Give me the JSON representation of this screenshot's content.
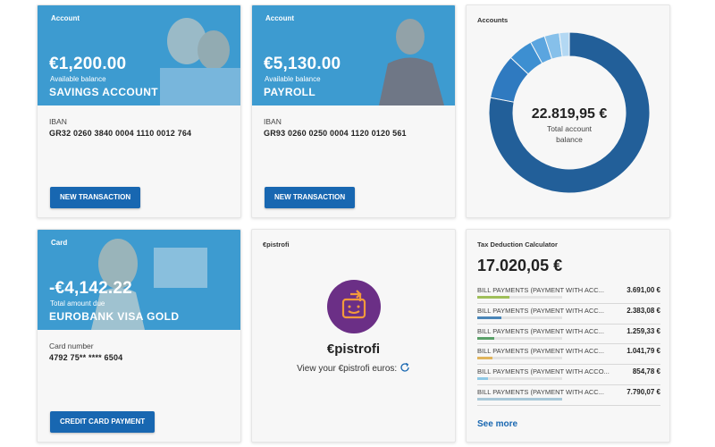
{
  "savings": {
    "tag": "Account",
    "amount": "€1,200.00",
    "amount_caption": "Available balance",
    "name": "SAVINGS ACCOUNT",
    "iban_label": "IBAN",
    "iban": "GR32 0260 3840 0004 1110 0012 764",
    "button": "NEW TRANSACTION"
  },
  "payroll": {
    "tag": "Account",
    "amount": "€5,130.00",
    "amount_caption": "Available balance",
    "name": "PAYROLL",
    "iban_label": "IBAN",
    "iban": "GR93 0260 0250 0004 1120 0120 561",
    "button": "NEW TRANSACTION"
  },
  "accounts": {
    "title": "Accounts",
    "total": "22.819,95 €",
    "caption": "Total account balance",
    "chart_data": {
      "type": "pie",
      "values": [
        0.78,
        0.09,
        0.05,
        0.03,
        0.03,
        0.02
      ],
      "colors": [
        "#225f99",
        "#2f7ac0",
        "#3d8fd1",
        "#5ba5df",
        "#86c0ea",
        "#b3d8f3"
      ]
    }
  },
  "card": {
    "tag": "Card",
    "amount": "-€4,142.22",
    "amount_caption": "Total amount due",
    "name": "EUROBANK VISA GOLD",
    "number_label": "Card number",
    "number": "4792 75** **** 6504",
    "button": "CREDIT CARD PAYMENT"
  },
  "epistrofi": {
    "tag": "€pistrofi",
    "title": "€pistrofi",
    "subtitle": "View your €pistrofi euros:",
    "icon": "refresh-icon"
  },
  "tax": {
    "title": "Tax Deduction Calculator",
    "total": "17.020,05 €",
    "rows": [
      {
        "label": "BILL PAYMENTS (PAYMENT WITH ACC...",
        "value": "3.691,00 €",
        "fill": 0.38,
        "color": "#9fbf5a"
      },
      {
        "label": "BILL PAYMENTS (PAYMENT WITH ACC...",
        "value": "2.383,08 €",
        "fill": 0.28,
        "color": "#4a86b8"
      },
      {
        "label": "BILL PAYMENTS (PAYMENT WITH ACC...",
        "value": "1.259,33 €",
        "fill": 0.2,
        "color": "#5aa068"
      },
      {
        "label": "BILL PAYMENTS (PAYMENT WITH ACC...",
        "value": "1.041,79 €",
        "fill": 0.18,
        "color": "#e0b45c"
      },
      {
        "label": "BILL PAYMENTS (PAYMENT WITH ACCO...",
        "value": "854,78 €",
        "fill": 0.13,
        "color": "#8fc9e6"
      },
      {
        "label": "BILL PAYMENTS (PAYMENT WITH ACC...",
        "value": "7.790,07 €",
        "fill": 1.0,
        "color": "#a8c8d8"
      }
    ],
    "see_more": "See more"
  }
}
